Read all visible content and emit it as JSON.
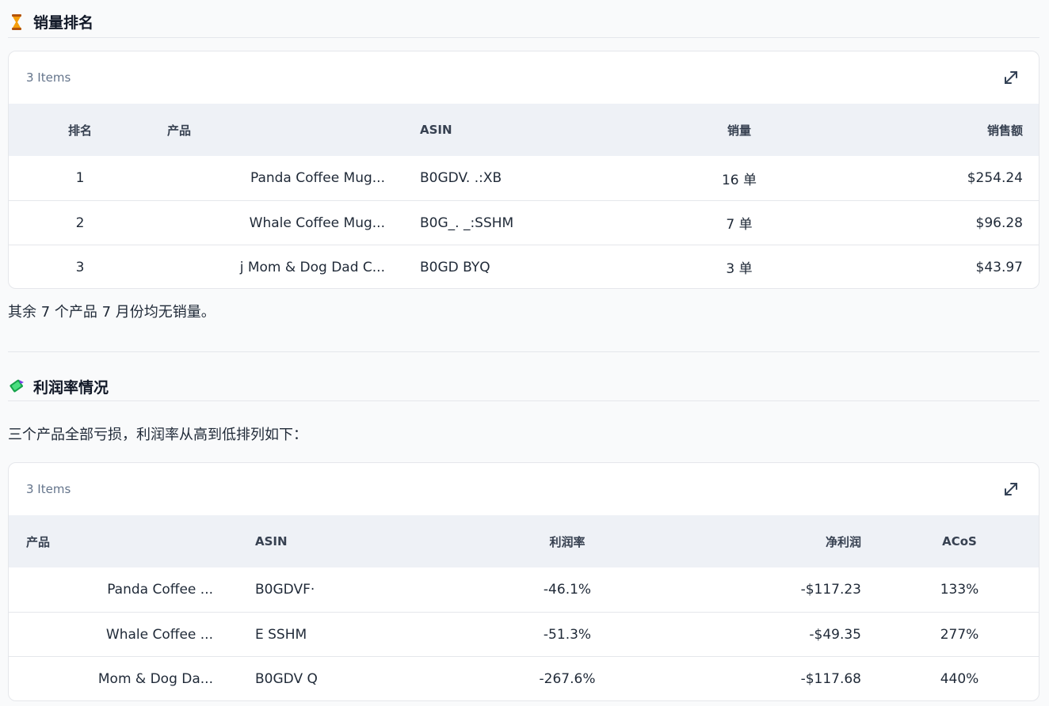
{
  "sales_section": {
    "icon": "trophy-icon",
    "title": "销量排名",
    "table": {
      "count_label": "3 Items",
      "headers": {
        "rank": "排名",
        "product": "产品",
        "asin": "ASIN",
        "units": "销量",
        "revenue": "销售额"
      },
      "rows": [
        {
          "rank": "1",
          "product": "Panda Coffee Mug...",
          "asin": "B0GDV. .:XB",
          "units": "16 单",
          "revenue": "$254.24"
        },
        {
          "rank": "2",
          "product": "Whale Coffee Mug...",
          "asin": "B0G_. _:SSHM",
          "units": "7 单",
          "revenue": "$96.28"
        },
        {
          "rank": "3",
          "product": "j Mom & Dog Dad C...",
          "asin": "B0GD      BYQ",
          "units": "3 单",
          "revenue": "$43.97"
        }
      ]
    },
    "note": "其余 7 个产品 7 月份均无销量。"
  },
  "profit_section": {
    "icon": "money-icon",
    "title": "利润率情况",
    "intro": "三个产品全部亏损，利润率从高到低排列如下：",
    "table": {
      "count_label": "3 Items",
      "headers": {
        "product": "产品",
        "asin": "ASIN",
        "margin": "利润率",
        "net": "净利润",
        "acos": "ACoS"
      },
      "rows": [
        {
          "product": "Panda Coffee ...",
          "asin": "B0GDVF·",
          "margin": "-46.1%",
          "net": "-$117.23",
          "acos": "133%"
        },
        {
          "product": "Whale Coffee ...",
          "asin": "E          SSHM",
          "margin": "-51.3%",
          "net": "-$49.35",
          "acos": "277%"
        },
        {
          "product": "Mom & Dog Da...",
          "asin": "B0GDV       Q",
          "margin": "-267.6%",
          "net": "-$117.68",
          "acos": "440%"
        }
      ]
    }
  },
  "colors": {
    "header_bg": "#eef1f6",
    "border": "#e5e7eb",
    "muted": "#64748b"
  }
}
